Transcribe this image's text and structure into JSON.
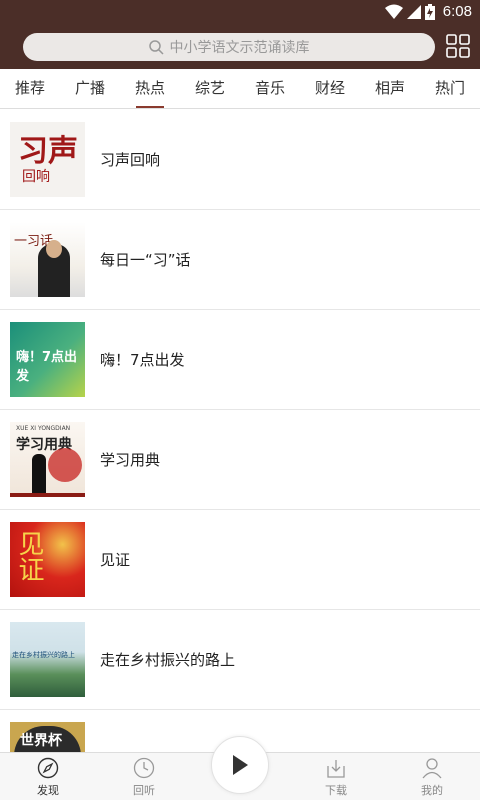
{
  "status_bar": {
    "time": "6:08"
  },
  "search": {
    "placeholder": "中小学语文示范诵读库"
  },
  "tabs": [
    {
      "label": "推荐"
    },
    {
      "label": "广播"
    },
    {
      "label": "热点",
      "active": true
    },
    {
      "label": "综艺"
    },
    {
      "label": "音乐"
    },
    {
      "label": "财经"
    },
    {
      "label": "相声"
    },
    {
      "label": "热门"
    }
  ],
  "items": [
    {
      "title": "习声回响",
      "thumb_text": "习声",
      "thumb_sub": "回响"
    },
    {
      "title": "每日一“习”话",
      "thumb_text": "一习话"
    },
    {
      "title": "嗨！7点出发",
      "thumb_text": "嗨！7点出发"
    },
    {
      "title": "学习用典",
      "thumb_text": "学习用典",
      "thumb_sub": "XUE XI YONGDIAN"
    },
    {
      "title": "见证",
      "thumb_text": "见证"
    },
    {
      "title": "走在乡村振兴的路上",
      "thumb_text": "走在乡村振兴的路上"
    },
    {
      "title": "",
      "thumb_text": "世界杯"
    }
  ],
  "bottom_nav": {
    "discover": "发现",
    "history": "回听",
    "download": "下载",
    "mine": "我的"
  },
  "colors": {
    "header": "#4b2e28",
    "accent": "#8a3a2e"
  }
}
